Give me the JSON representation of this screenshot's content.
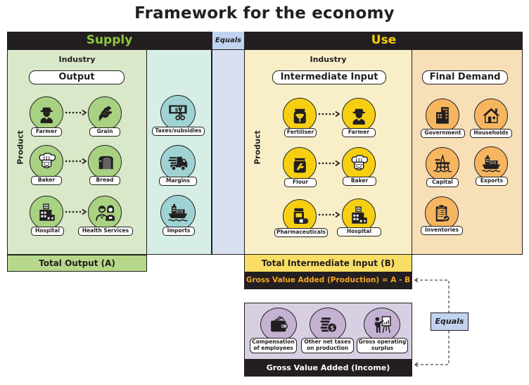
{
  "title": "Framework for the economy",
  "header": {
    "supply": "Supply",
    "equals": "Equals",
    "use": "Use"
  },
  "supply": {
    "industry_heading": "Industry",
    "output_heading": "Output",
    "product_label": "Product",
    "rows": [
      {
        "from": {
          "label": "Farmer",
          "icon": "farmer-icon"
        },
        "to": {
          "label": "Grain",
          "icon": "grain-icon"
        }
      },
      {
        "from": {
          "label": "Baker",
          "icon": "baker-icon"
        },
        "to": {
          "label": "Bread",
          "icon": "bread-icon"
        }
      },
      {
        "from": {
          "label": "Hospital",
          "icon": "hospital-icon"
        },
        "to": {
          "label": "Health Services",
          "icon": "health-services-icon"
        }
      }
    ],
    "other_items": [
      {
        "label": "Taxes/subsidies",
        "icon": "taxes-icon"
      },
      {
        "label": "Margins",
        "icon": "truck-icon"
      },
      {
        "label": "Imports",
        "icon": "ship-icon"
      }
    ],
    "total": "Total Output (A)"
  },
  "use": {
    "industry_heading": "Industry",
    "intermediate_heading": "Intermediate Input",
    "final_heading": "Final Demand",
    "product_label": "Product",
    "rows": [
      {
        "from": {
          "label": "Fertiliser",
          "icon": "fertiliser-icon"
        },
        "to": {
          "label": "Farmer",
          "icon": "farmer-icon"
        }
      },
      {
        "from": {
          "label": "Flour",
          "icon": "flour-icon"
        },
        "to": {
          "label": "Baker",
          "icon": "baker-icon"
        }
      },
      {
        "from": {
          "label": "Pharmaceuticals",
          "icon": "pharmaceuticals-icon"
        },
        "to": {
          "label": "Hospital",
          "icon": "hospital-icon"
        }
      }
    ],
    "final_demand": [
      {
        "label": "Government",
        "icon": "government-icon"
      },
      {
        "label": "Households",
        "icon": "house-icon"
      },
      {
        "label": "Capital",
        "icon": "oil-rig-icon"
      },
      {
        "label": "Exports",
        "icon": "ship-icon"
      },
      {
        "label": "Inventories",
        "icon": "clipboard-icon"
      }
    ],
    "total": "Total Intermediate Input (B)",
    "gva_production": "Gross Value Added (Production) = A - B"
  },
  "income": {
    "items": [
      {
        "line1": "Compensation",
        "line2": "of employees",
        "icon": "wallet-icon"
      },
      {
        "line1": "Other net taxes",
        "line2": "on production",
        "icon": "coins-icon"
      },
      {
        "line1": "Gross operating",
        "line2": "surplus",
        "icon": "presentation-icon"
      }
    ],
    "gva_income": "Gross Value Added (Income)",
    "equals": "Equals"
  },
  "colors": {
    "supply_accent": "#8dc63f",
    "use_accent": "#f4d00c",
    "gva_production_text": "#f7a823",
    "equals_fill": "#c1d3f0"
  }
}
